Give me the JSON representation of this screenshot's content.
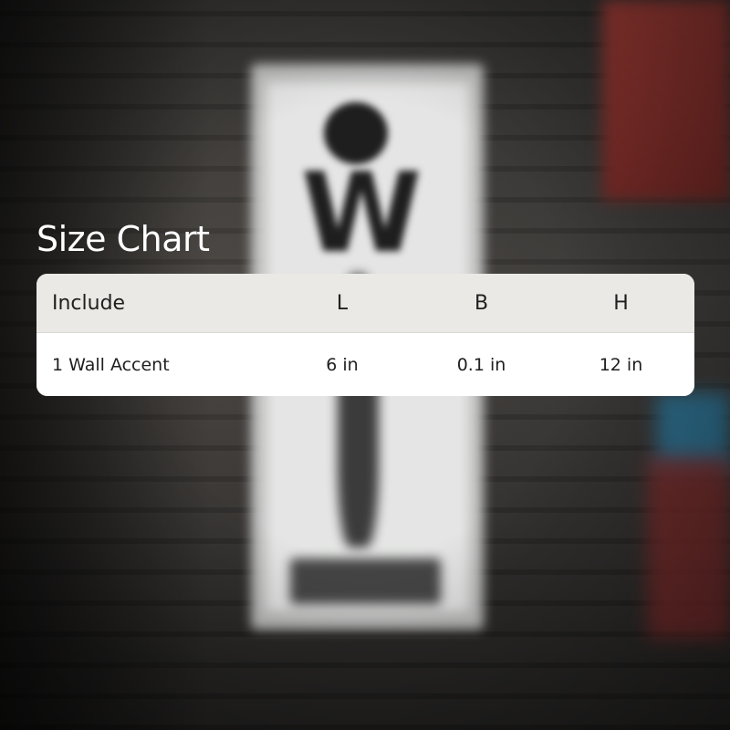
{
  "title": "Size Chart",
  "table": {
    "headers": [
      "Include",
      "L",
      "B",
      "H"
    ],
    "rows": [
      [
        "1 Wall Accent",
        "6 in",
        "0.1 in",
        "12 in"
      ]
    ]
  },
  "colors": {
    "header_bg": "#ebe9e5",
    "row_bg": "#ffffff",
    "title_text": "#ffffff",
    "cell_text": "#1f1f1f"
  }
}
